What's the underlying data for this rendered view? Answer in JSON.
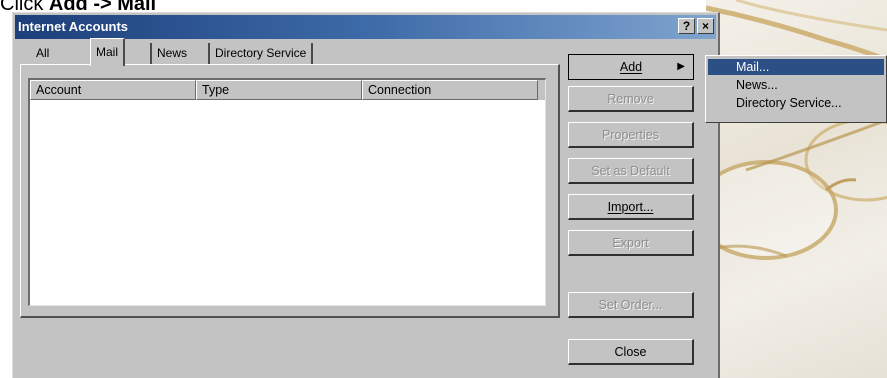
{
  "caption": {
    "prefix": "Click ",
    "bold": "Add -> Mail"
  },
  "window": {
    "title": "Internet Accounts",
    "help_glyph": "?",
    "close_glyph": "×"
  },
  "tabs": [
    {
      "label": "All"
    },
    {
      "label": "Mail",
      "selected": true
    },
    {
      "label": "News"
    },
    {
      "label": "Directory Service"
    }
  ],
  "list": {
    "columns": [
      "Account",
      "Type",
      "Connection"
    ],
    "rows": []
  },
  "buttons": {
    "add": "Add",
    "remove": "Remove",
    "properties": "Properties",
    "set_default": "Set as Default",
    "import": "Import...",
    "export": "Export",
    "set_order": "Set Order...",
    "close": "Close"
  },
  "submenu": {
    "items": [
      {
        "label": "Mail...",
        "highlighted": true
      },
      {
        "label": "News..."
      },
      {
        "label": "Directory Service..."
      }
    ]
  },
  "colors": {
    "titlebar": "#1d3f7a",
    "dialog_face": "#c3c3c3",
    "menu_highlight": "#2c4f86"
  }
}
